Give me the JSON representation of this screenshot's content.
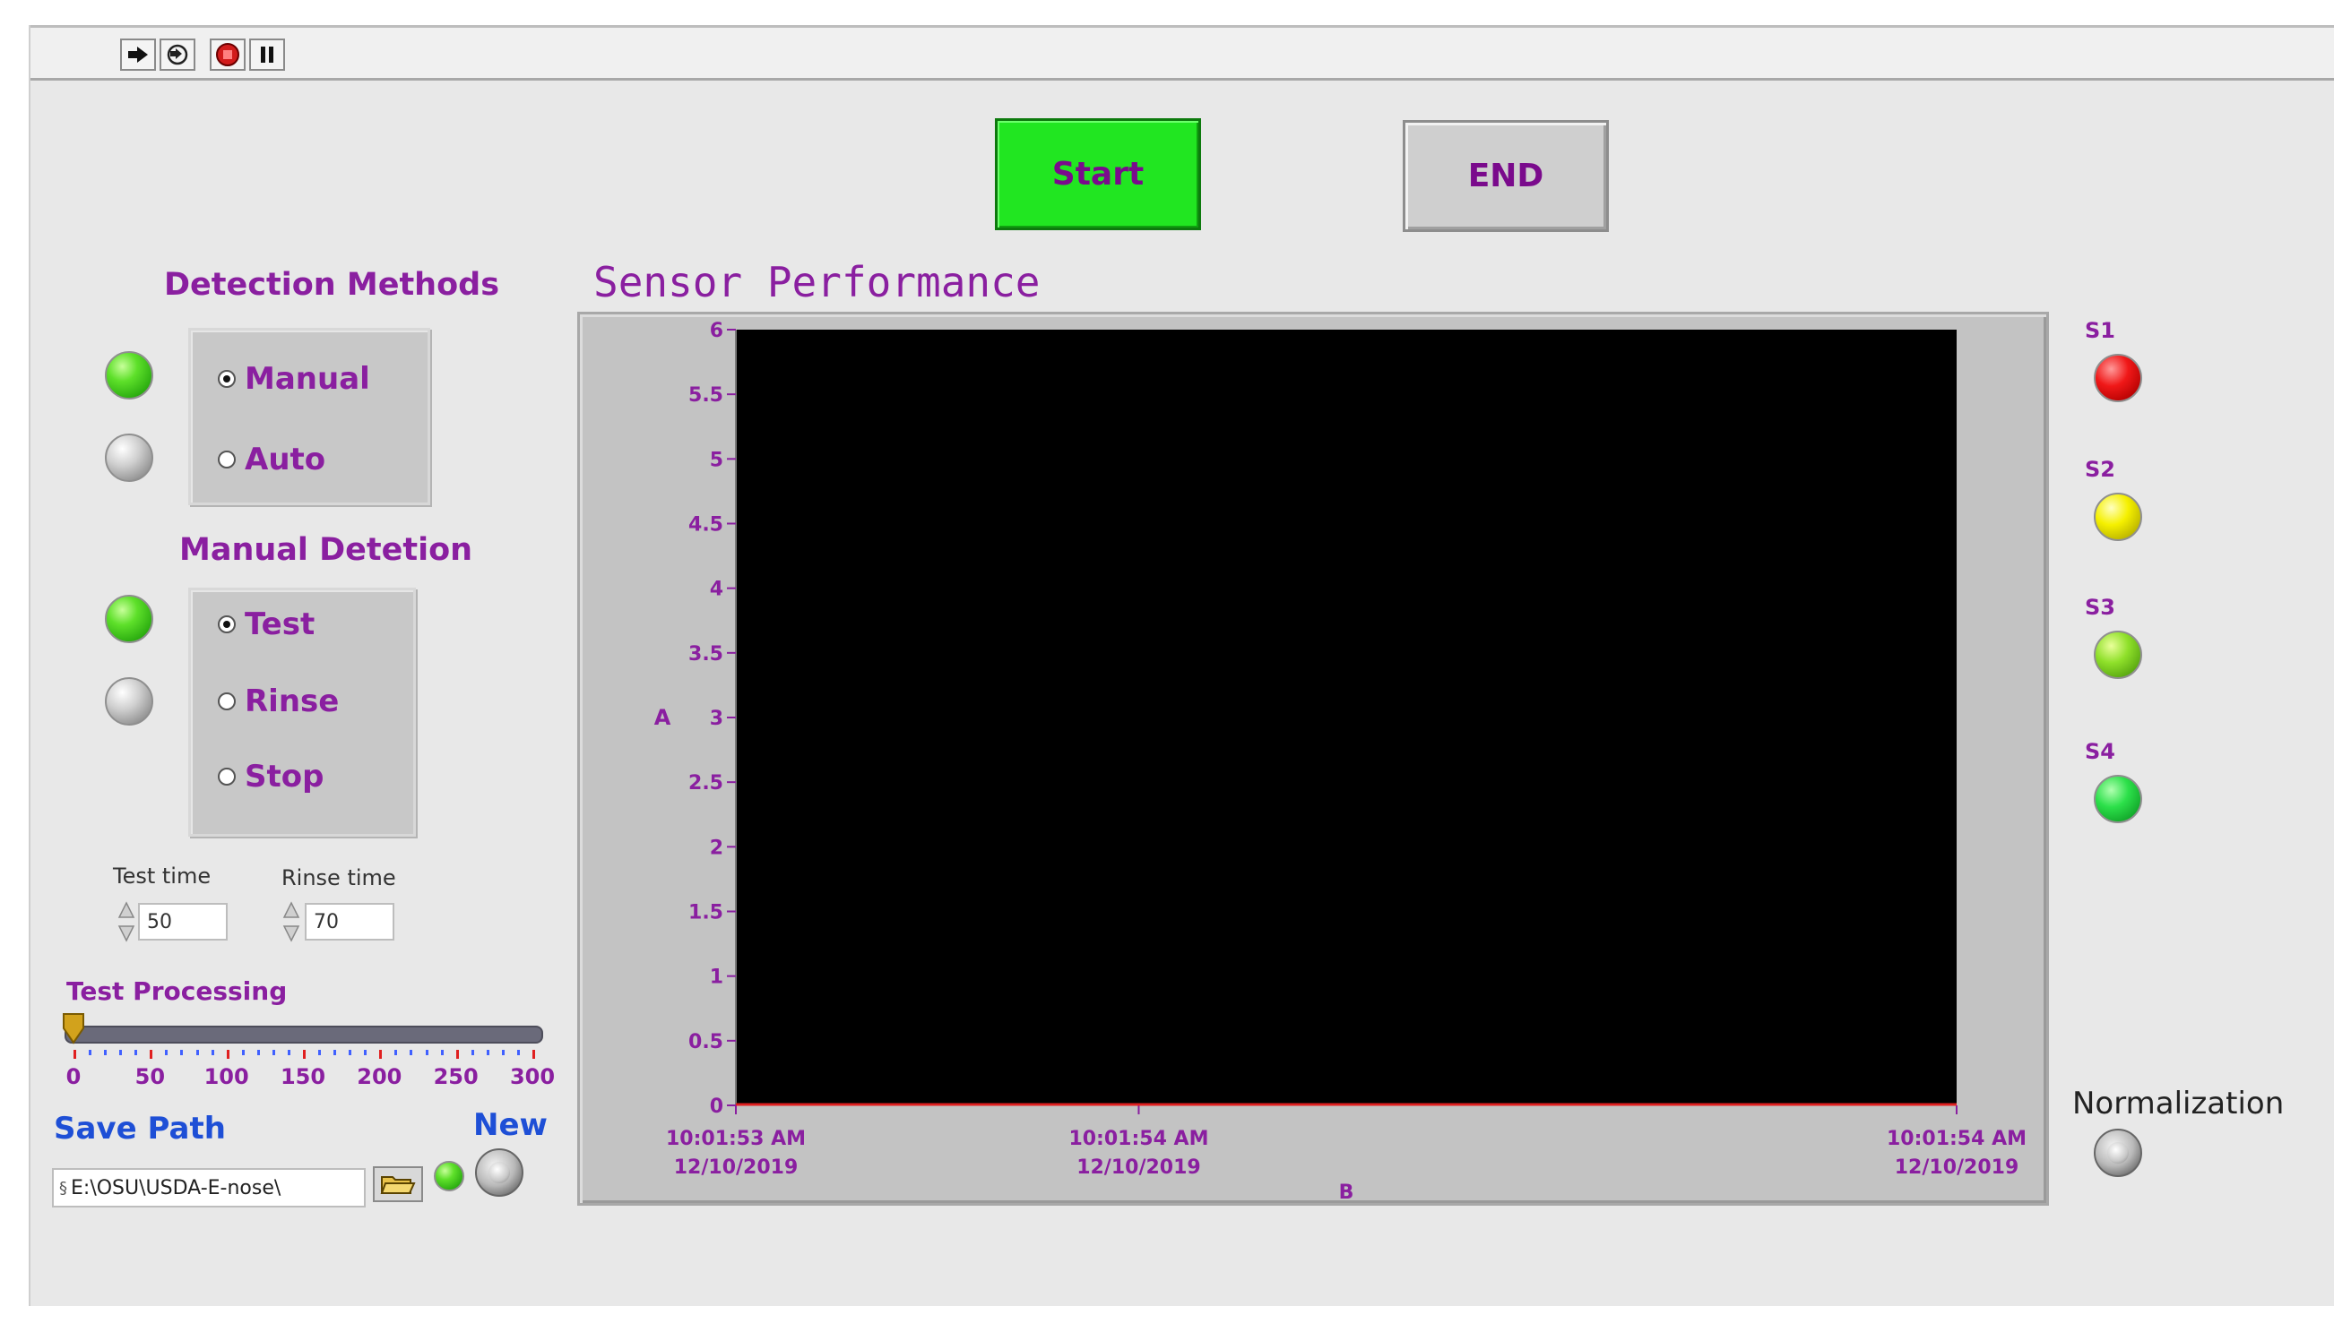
{
  "toolbar": {
    "icons": [
      "run-arrow-icon",
      "run-continuously-icon",
      "abort-stop-icon",
      "pause-icon"
    ]
  },
  "controls": {
    "start_label": "Start",
    "end_label": "END"
  },
  "detection_methods": {
    "title": "Detection Methods",
    "options": [
      {
        "label": "Manual",
        "selected": true,
        "led": "green"
      },
      {
        "label": "Auto",
        "selected": false,
        "led": "grey"
      }
    ]
  },
  "manual_detection": {
    "title": "Manual Detetion",
    "options": [
      {
        "label": "Test",
        "selected": true,
        "led": "green"
      },
      {
        "label": "Rinse",
        "selected": false,
        "led": "grey"
      },
      {
        "label": "Stop",
        "selected": false
      }
    ]
  },
  "timing": {
    "test_time_label": "Test time",
    "test_time_value": "50",
    "rinse_time_label": "Rinse time",
    "rinse_time_value": "70"
  },
  "test_processing": {
    "title": "Test Processing",
    "value": 0,
    "min": 0,
    "max": 300,
    "tick_labels": [
      "0",
      "50",
      "100",
      "150",
      "200",
      "250",
      "300"
    ]
  },
  "save_path": {
    "label": "Save Path",
    "value": "E:\\OSU\\USDA-E-nose\\",
    "new_label": "New",
    "new_led": "green"
  },
  "sensors": [
    {
      "label": "S1",
      "color": "red"
    },
    {
      "label": "S2",
      "color": "yellow"
    },
    {
      "label": "S3",
      "color": "lime"
    },
    {
      "label": "S4",
      "color": "bright"
    }
  ],
  "normalization": {
    "label": "Normalization"
  },
  "colors": {
    "label_purple": "#8a1fa0",
    "plot_background": "#000000",
    "trace": "#e02020",
    "start_green": "#21e621"
  },
  "chart_data": {
    "type": "line",
    "title": "Sensor Performance",
    "xlabel": "B",
    "ylabel": "A",
    "ylim": [
      0,
      6
    ],
    "y_ticks": [
      "0",
      "0.5",
      "1",
      "1.5",
      "2",
      "2.5",
      "3",
      "3.5",
      "4",
      "4.5",
      "5",
      "5.5",
      "6"
    ],
    "x_ticks": [
      {
        "time": "10:01:53 AM",
        "date": "12/10/2019"
      },
      {
        "time": "10:01:54 AM",
        "date": "12/10/2019"
      },
      {
        "time": "10:01:54 AM",
        "date": "12/10/2019"
      }
    ],
    "series": [
      {
        "values": [
          0,
          0,
          0
        ]
      }
    ]
  }
}
